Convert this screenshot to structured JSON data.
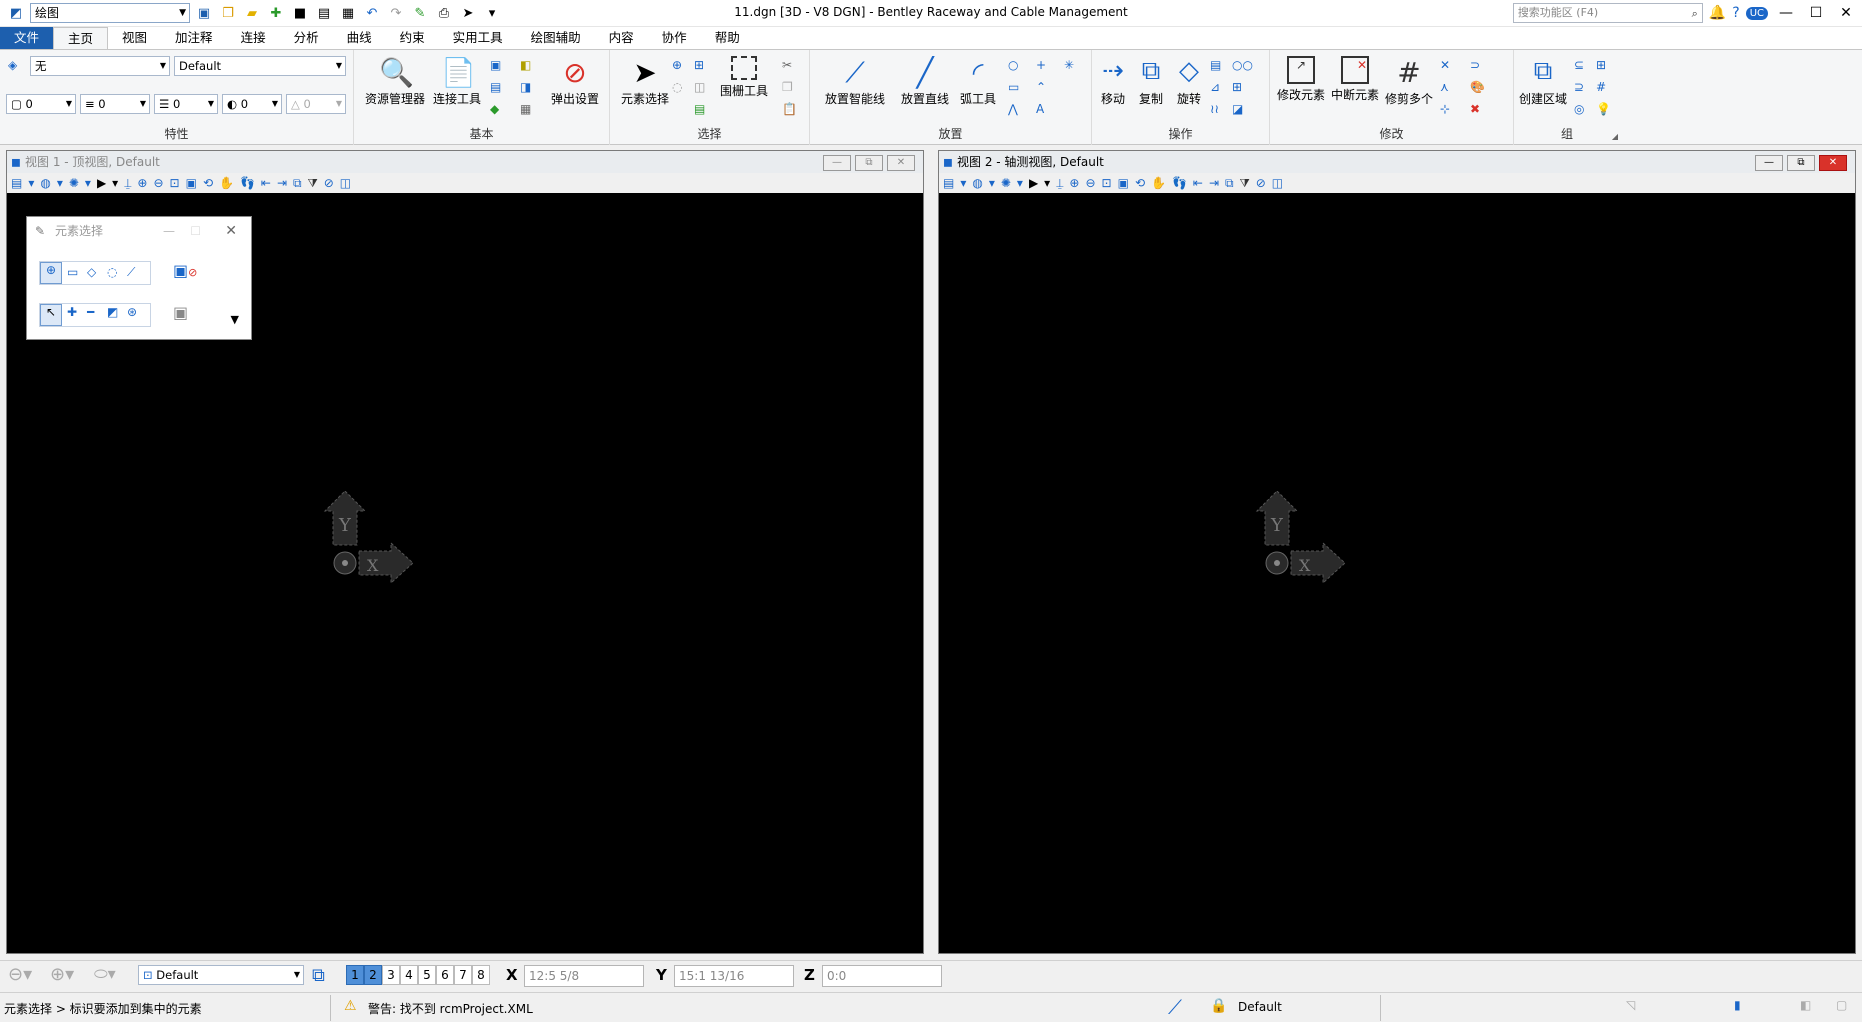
{
  "window": {
    "title": "11.dgn [3D - V8 DGN] - Bentley Raceway and Cable Management",
    "workflow": "绘图",
    "search_placeholder": "搜索功能区 (F4)",
    "user_badge": "UC"
  },
  "tabs": [
    "文件",
    "主页",
    "视图",
    "加注释",
    "连接",
    "分析",
    "曲线",
    "约束",
    "实用工具",
    "绘图辅助",
    "内容",
    "协作",
    "帮助"
  ],
  "ribbon": {
    "attributes": {
      "label": "特性",
      "level": "无",
      "style": "Default",
      "color": "0",
      "weight": "0",
      "linestyle": "0",
      "transparency": "0",
      "priority": "0"
    },
    "basic": {
      "label": "基本",
      "explorer": "资源管理器",
      "attach": "连接工具",
      "popup": "弹出设置"
    },
    "selection": {
      "label": "选择",
      "element_select": "元素选择",
      "fence": "围栅工具"
    },
    "placement": {
      "label": "放置",
      "smartline": "放置智能线",
      "line": "放置直线",
      "arc": "弧工具"
    },
    "manipulate": {
      "label": "操作",
      "move": "移动",
      "copy": "复制",
      "rotate": "旋转"
    },
    "modify": {
      "label": "修改",
      "modify_element": "修改元素",
      "break_element": "中断元素",
      "trim_multiple": "修剪多个"
    },
    "group": {
      "label": "组",
      "create_region": "创建区域"
    }
  },
  "views": [
    {
      "title": "视图 1 - 顶视图, Default"
    },
    {
      "title": "视图 2 - 轴测视图, Default"
    }
  ],
  "element_selection_dialog": {
    "title": "元素选择"
  },
  "bottombar": {
    "model": "Default",
    "view_numbers": [
      "1",
      "2",
      "3",
      "4",
      "5",
      "6",
      "7",
      "8"
    ],
    "x_label": "X",
    "x_value": "12:5 5/8",
    "y_label": "Y",
    "y_value": "15:1 13/16",
    "z_label": "Z",
    "z_value": "0:0"
  },
  "status": {
    "prompt": "元素选择 > 标识要添加到集中的元素",
    "message": "警告: 找不到 rcmProject.XML",
    "level": "Default"
  },
  "colors": {
    "file_tab": "#1d5fae",
    "accent": "#1a66c8"
  }
}
